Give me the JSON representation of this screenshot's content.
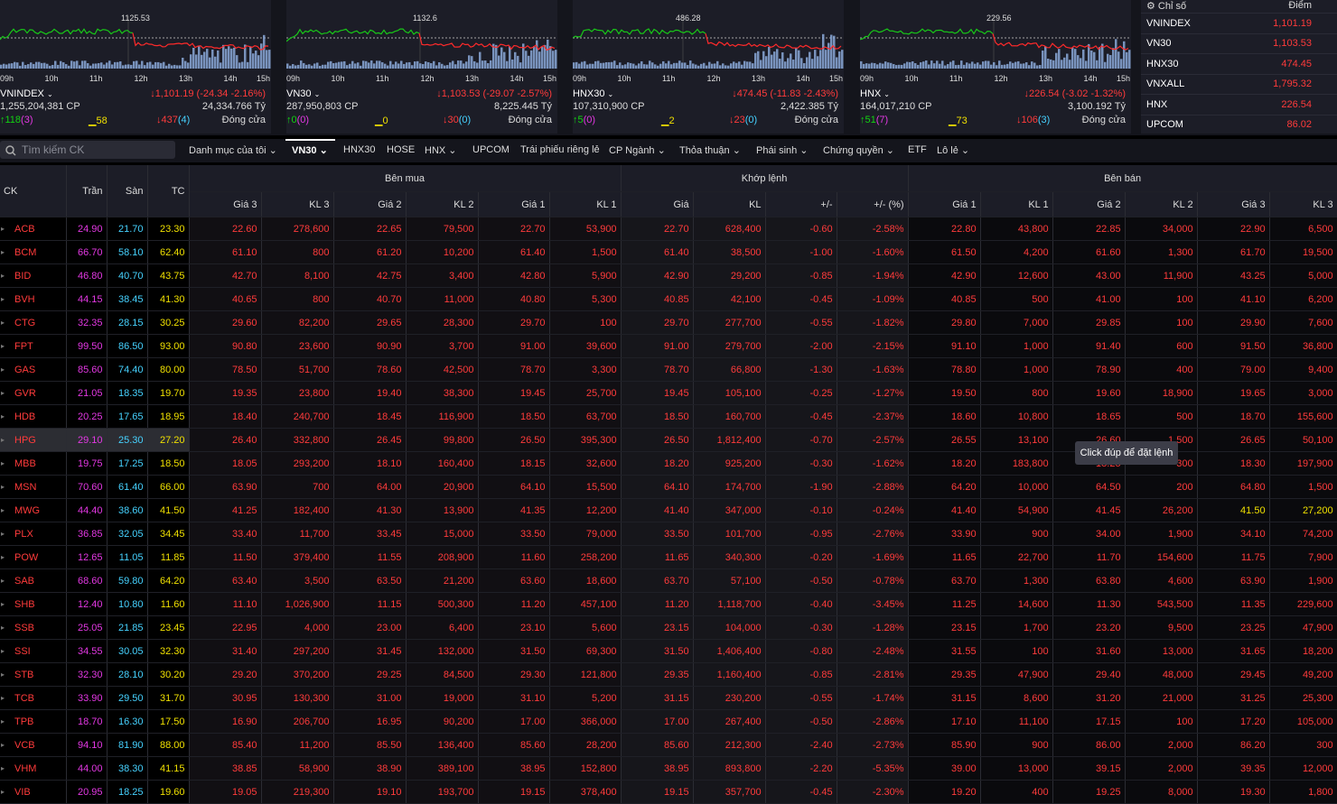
{
  "minis": [
    {
      "name": "VNINDEX",
      "peak": "1125.53",
      "vol": "1,255,204,381 CP",
      "change": "↓1,101.19 (-24.34 -2.16%)",
      "value": "24,334.766 Tỷ",
      "up": "↑118",
      "upCeil": "(3)",
      "same": "▁58",
      "down": "↓437",
      "downFloor": "(4)",
      "status": "Đóng cửa"
    },
    {
      "name": "VN30",
      "peak": "1132.6",
      "vol": "287,950,803 CP",
      "change": "↓1,103.53 (-29.07 -2.57%)",
      "value": "8,225.445 Tỷ",
      "up": "↑0",
      "upCeil": "(0)",
      "same": "▁0",
      "down": "↓30",
      "downFloor": "(0)",
      "status": "Đóng cửa"
    },
    {
      "name": "HNX30",
      "peak": "486.28",
      "vol": "107,310,900 CP",
      "change": "↓474.45 (-11.83 -2.43%)",
      "value": "2,422.385 Tỷ",
      "up": "↑5",
      "upCeil": "(0)",
      "same": "▁2",
      "down": "↓23",
      "downFloor": "(0)",
      "status": "Đóng cửa"
    },
    {
      "name": "HNX",
      "peak": "229.56",
      "vol": "164,017,210 CP",
      "change": "↓226.54 (-3.02 -1.32%)",
      "value": "3,100.192 Tỷ",
      "up": "↑51",
      "upCeil": "(7)",
      "same": "▁73",
      "down": "↓106",
      "downFloor": "(3)",
      "status": "Đóng cửa"
    }
  ],
  "hours": [
    "09h",
    "10h",
    "11h",
    "12h",
    "13h",
    "14h",
    "15h"
  ],
  "index_panel": {
    "header_name": "⚙ Chỉ số",
    "header_value": "Điểm",
    "rows": [
      {
        "name": "VNINDEX",
        "value": "1,101.19"
      },
      {
        "name": "VN30",
        "value": "1,103.53"
      },
      {
        "name": "HNX30",
        "value": "474.45"
      },
      {
        "name": "VNXALL",
        "value": "1,795.32"
      },
      {
        "name": "HNX",
        "value": "226.54"
      },
      {
        "name": "UPCOM",
        "value": "86.02"
      }
    ]
  },
  "toolbar": {
    "search_placeholder": "Tìm kiếm CK",
    "tabs": [
      "Danh mục của tôi ⌄",
      "VN30 ⌄",
      "HNX30",
      "HOSE",
      "HNX ⌄",
      "UPCOM",
      "Trái phiếu riêng lẻ",
      "CP Ngành ⌄",
      "Thỏa thuận ⌄",
      "Phái sinh ⌄",
      "Chứng quyền ⌄",
      "ETF",
      "Lô lẻ ⌄"
    ]
  },
  "table": {
    "group_buy": "Bên mua",
    "group_match": "Khớp lệnh",
    "group_sell": "Bên bán",
    "h_ck": "CK",
    "h_ceil": "Trần",
    "h_floor": "Sàn",
    "h_ref": "TC",
    "sub": [
      "Giá 3",
      "KL 3",
      "Giá 2",
      "KL 2",
      "Giá 1",
      "KL 1",
      "Giá",
      "KL",
      "+/-",
      "+/- (%)",
      "Giá 1",
      "KL 1",
      "Giá 2",
      "KL 2",
      "Giá 3",
      "KL 3"
    ],
    "rows": [
      [
        "ACB",
        "24.90",
        "21.70",
        "23.30",
        "22.60",
        "278,600",
        "22.65",
        "79,500",
        "22.70",
        "53,900",
        "22.70",
        "628,400",
        "-0.60",
        "-2.58%",
        "22.80",
        "43,800",
        "22.85",
        "34,000",
        "22.90",
        "6,500"
      ],
      [
        "BCM",
        "66.70",
        "58.10",
        "62.40",
        "61.10",
        "800",
        "61.20",
        "10,200",
        "61.40",
        "1,500",
        "61.40",
        "38,500",
        "-1.00",
        "-1.60%",
        "61.50",
        "4,200",
        "61.60",
        "1,300",
        "61.70",
        "19,500"
      ],
      [
        "BID",
        "46.80",
        "40.70",
        "43.75",
        "42.70",
        "8,100",
        "42.75",
        "3,400",
        "42.80",
        "5,900",
        "42.90",
        "29,200",
        "-0.85",
        "-1.94%",
        "42.90",
        "12,600",
        "43.00",
        "11,900",
        "43.25",
        "5,000"
      ],
      [
        "BVH",
        "44.15",
        "38.45",
        "41.30",
        "40.65",
        "800",
        "40.70",
        "11,000",
        "40.80",
        "5,300",
        "40.85",
        "42,100",
        "-0.45",
        "-1.09%",
        "40.85",
        "500",
        "41.00",
        "100",
        "41.10",
        "6,200"
      ],
      [
        "CTG",
        "32.35",
        "28.15",
        "30.25",
        "29.60",
        "82,200",
        "29.65",
        "28,300",
        "29.70",
        "100",
        "29.70",
        "277,700",
        "-0.55",
        "-1.82%",
        "29.80",
        "7,000",
        "29.85",
        "100",
        "29.90",
        "7,600"
      ],
      [
        "FPT",
        "99.50",
        "86.50",
        "93.00",
        "90.80",
        "23,600",
        "90.90",
        "3,700",
        "91.00",
        "39,600",
        "91.00",
        "279,700",
        "-2.00",
        "-2.15%",
        "91.10",
        "1,000",
        "91.40",
        "600",
        "91.50",
        "36,800"
      ],
      [
        "GAS",
        "85.60",
        "74.40",
        "80.00",
        "78.50",
        "51,700",
        "78.60",
        "42,500",
        "78.70",
        "3,300",
        "78.70",
        "66,800",
        "-1.30",
        "-1.63%",
        "78.80",
        "1,000",
        "78.90",
        "400",
        "79.00",
        "9,400"
      ],
      [
        "GVR",
        "21.05",
        "18.35",
        "19.70",
        "19.35",
        "23,800",
        "19.40",
        "38,300",
        "19.45",
        "25,700",
        "19.45",
        "105,100",
        "-0.25",
        "-1.27%",
        "19.50",
        "800",
        "19.60",
        "18,900",
        "19.65",
        "3,000"
      ],
      [
        "HDB",
        "20.25",
        "17.65",
        "18.95",
        "18.40",
        "240,700",
        "18.45",
        "116,900",
        "18.50",
        "63,700",
        "18.50",
        "160,700",
        "-0.45",
        "-2.37%",
        "18.60",
        "10,800",
        "18.65",
        "500",
        "18.70",
        "155,600"
      ],
      [
        "HPG",
        "29.10",
        "25.30",
        "27.20",
        "26.40",
        "332,800",
        "26.45",
        "99,800",
        "26.50",
        "395,300",
        "26.50",
        "1,812,400",
        "-0.70",
        "-2.57%",
        "26.55",
        "13,100",
        "26.60",
        "1,500",
        "26.65",
        "50,100"
      ],
      [
        "MBB",
        "19.75",
        "17.25",
        "18.50",
        "18.05",
        "293,200",
        "18.10",
        "160,400",
        "18.15",
        "32,600",
        "18.20",
        "925,200",
        "-0.30",
        "-1.62%",
        "18.20",
        "183,800",
        "18.25",
        "300",
        "18.30",
        "197,900"
      ],
      [
        "MSN",
        "70.60",
        "61.40",
        "66.00",
        "63.90",
        "700",
        "64.00",
        "20,900",
        "64.10",
        "15,500",
        "64.10",
        "174,700",
        "-1.90",
        "-2.88%",
        "64.20",
        "10,000",
        "64.50",
        "200",
        "64.80",
        "1,500"
      ],
      [
        "MWG",
        "44.40",
        "38.60",
        "41.50",
        "41.25",
        "182,400",
        "41.30",
        "13,900",
        "41.35",
        "12,200",
        "41.40",
        "347,000",
        "-0.10",
        "-0.24%",
        "41.40",
        "54,900",
        "41.45",
        "26,200",
        "41.50",
        "27,200"
      ],
      [
        "PLX",
        "36.85",
        "32.05",
        "34.45",
        "33.40",
        "11,700",
        "33.45",
        "15,000",
        "33.50",
        "79,000",
        "33.50",
        "101,700",
        "-0.95",
        "-2.76%",
        "33.90",
        "900",
        "34.00",
        "1,900",
        "34.10",
        "74,200"
      ],
      [
        "POW",
        "12.65",
        "11.05",
        "11.85",
        "11.50",
        "379,400",
        "11.55",
        "208,900",
        "11.60",
        "258,200",
        "11.65",
        "340,300",
        "-0.20",
        "-1.69%",
        "11.65",
        "22,700",
        "11.70",
        "154,600",
        "11.75",
        "7,900"
      ],
      [
        "SAB",
        "68.60",
        "59.80",
        "64.20",
        "63.40",
        "3,500",
        "63.50",
        "21,200",
        "63.60",
        "18,600",
        "63.70",
        "57,100",
        "-0.50",
        "-0.78%",
        "63.70",
        "1,300",
        "63.80",
        "4,600",
        "63.90",
        "1,900"
      ],
      [
        "SHB",
        "12.40",
        "10.80",
        "11.60",
        "11.10",
        "1,026,900",
        "11.15",
        "500,300",
        "11.20",
        "457,100",
        "11.20",
        "1,118,700",
        "-0.40",
        "-3.45%",
        "11.25",
        "14,600",
        "11.30",
        "543,500",
        "11.35",
        "229,600"
      ],
      [
        "SSB",
        "25.05",
        "21.85",
        "23.45",
        "22.95",
        "4,000",
        "23.00",
        "6,400",
        "23.10",
        "5,600",
        "23.15",
        "104,000",
        "-0.30",
        "-1.28%",
        "23.15",
        "1,700",
        "23.20",
        "9,500",
        "23.25",
        "47,900"
      ],
      [
        "SSI",
        "34.55",
        "30.05",
        "32.30",
        "31.40",
        "297,200",
        "31.45",
        "132,000",
        "31.50",
        "69,300",
        "31.50",
        "1,406,400",
        "-0.80",
        "-2.48%",
        "31.55",
        "100",
        "31.60",
        "13,000",
        "31.65",
        "18,200"
      ],
      [
        "STB",
        "32.30",
        "28.10",
        "30.20",
        "29.20",
        "370,200",
        "29.25",
        "84,500",
        "29.30",
        "121,800",
        "29.35",
        "1,160,400",
        "-0.85",
        "-2.81%",
        "29.35",
        "47,900",
        "29.40",
        "48,000",
        "29.45",
        "49,200"
      ],
      [
        "TCB",
        "33.90",
        "29.50",
        "31.70",
        "30.95",
        "130,300",
        "31.00",
        "19,000",
        "31.10",
        "5,200",
        "31.15",
        "230,200",
        "-0.55",
        "-1.74%",
        "31.15",
        "8,600",
        "31.20",
        "21,000",
        "31.25",
        "25,300"
      ],
      [
        "TPB",
        "18.70",
        "16.30",
        "17.50",
        "16.90",
        "206,700",
        "16.95",
        "90,200",
        "17.00",
        "366,000",
        "17.00",
        "267,400",
        "-0.50",
        "-2.86%",
        "17.10",
        "11,100",
        "17.15",
        "100",
        "17.20",
        "105,000"
      ],
      [
        "VCB",
        "94.10",
        "81.90",
        "88.00",
        "85.40",
        "11,200",
        "85.50",
        "136,400",
        "85.60",
        "28,200",
        "85.60",
        "212,300",
        "-2.40",
        "-2.73%",
        "85.90",
        "900",
        "86.00",
        "2,000",
        "86.20",
        "300"
      ],
      [
        "VHM",
        "44.00",
        "38.30",
        "41.15",
        "38.85",
        "58,900",
        "38.90",
        "389,100",
        "38.95",
        "152,800",
        "38.95",
        "893,800",
        "-2.20",
        "-5.35%",
        "39.00",
        "13,000",
        "39.15",
        "2,000",
        "39.35",
        "12,000"
      ],
      [
        "VIB",
        "20.95",
        "18.25",
        "19.60",
        "19.05",
        "219,300",
        "19.10",
        "193,700",
        "19.15",
        "378,400",
        "19.15",
        "357,700",
        "-0.45",
        "-2.30%",
        "19.20",
        "400",
        "19.25",
        "8,000",
        "19.30",
        "1,800"
      ]
    ]
  },
  "tooltip": "Click đúp để đặt lệnh",
  "colors": {
    "down": "#ff3b3b",
    "up": "#12d212",
    "ref": "#f0e000",
    "ceil": "#e338e3",
    "floor": "#46d2ff",
    "bg": "#000000",
    "panel": "#1c1d27"
  }
}
